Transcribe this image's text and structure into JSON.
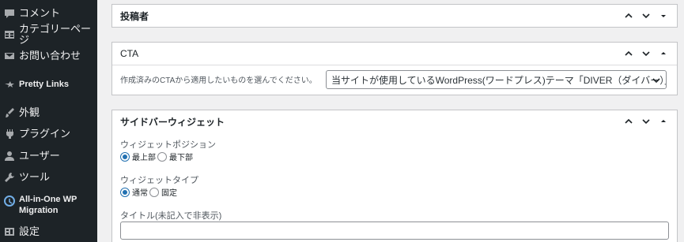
{
  "sidebar": {
    "items": [
      {
        "label": "コメント",
        "icon": "comment-icon"
      },
      {
        "label": "カテゴリーページ",
        "icon": "table-icon"
      },
      {
        "label": "お問い合わせ",
        "icon": "mail-icon"
      },
      {
        "label": "Pretty Links",
        "icon": "link-star-icon"
      },
      {
        "label": "外観",
        "icon": "brush-icon"
      },
      {
        "label": "プラグイン",
        "icon": "plugin-icon"
      },
      {
        "label": "ユーザー",
        "icon": "user-icon"
      },
      {
        "label": "ツール",
        "icon": "wrench-icon"
      },
      {
        "label_line1": "All-in-One WP",
        "label_line2": "Migration",
        "icon": "migration-icon"
      },
      {
        "label": "設定",
        "icon": "settings-icon"
      }
    ]
  },
  "author_panel": {
    "title": "投稿者"
  },
  "cta_panel": {
    "title": "CTA",
    "description": "作成済みのCTAから適用したいものを選んでください。",
    "selected": "当サイトが使用しているWordPress(ワードプレス)テーマ「DIVER（ダイバー）」"
  },
  "sidebar_widget_panel": {
    "title": "サイドバーウィジェット",
    "position_label": "ウィジェットポジション",
    "position_options": [
      "最上部",
      "最下部"
    ],
    "type_label": "ウィジェットタイプ",
    "type_options": [
      "通常",
      "固定"
    ],
    "title_field_label": "タイトル(未記入で非表示)",
    "title_field_value": ""
  },
  "colors": {
    "sidebar_bg": "#1d2327",
    "accent": "#2271b1"
  }
}
